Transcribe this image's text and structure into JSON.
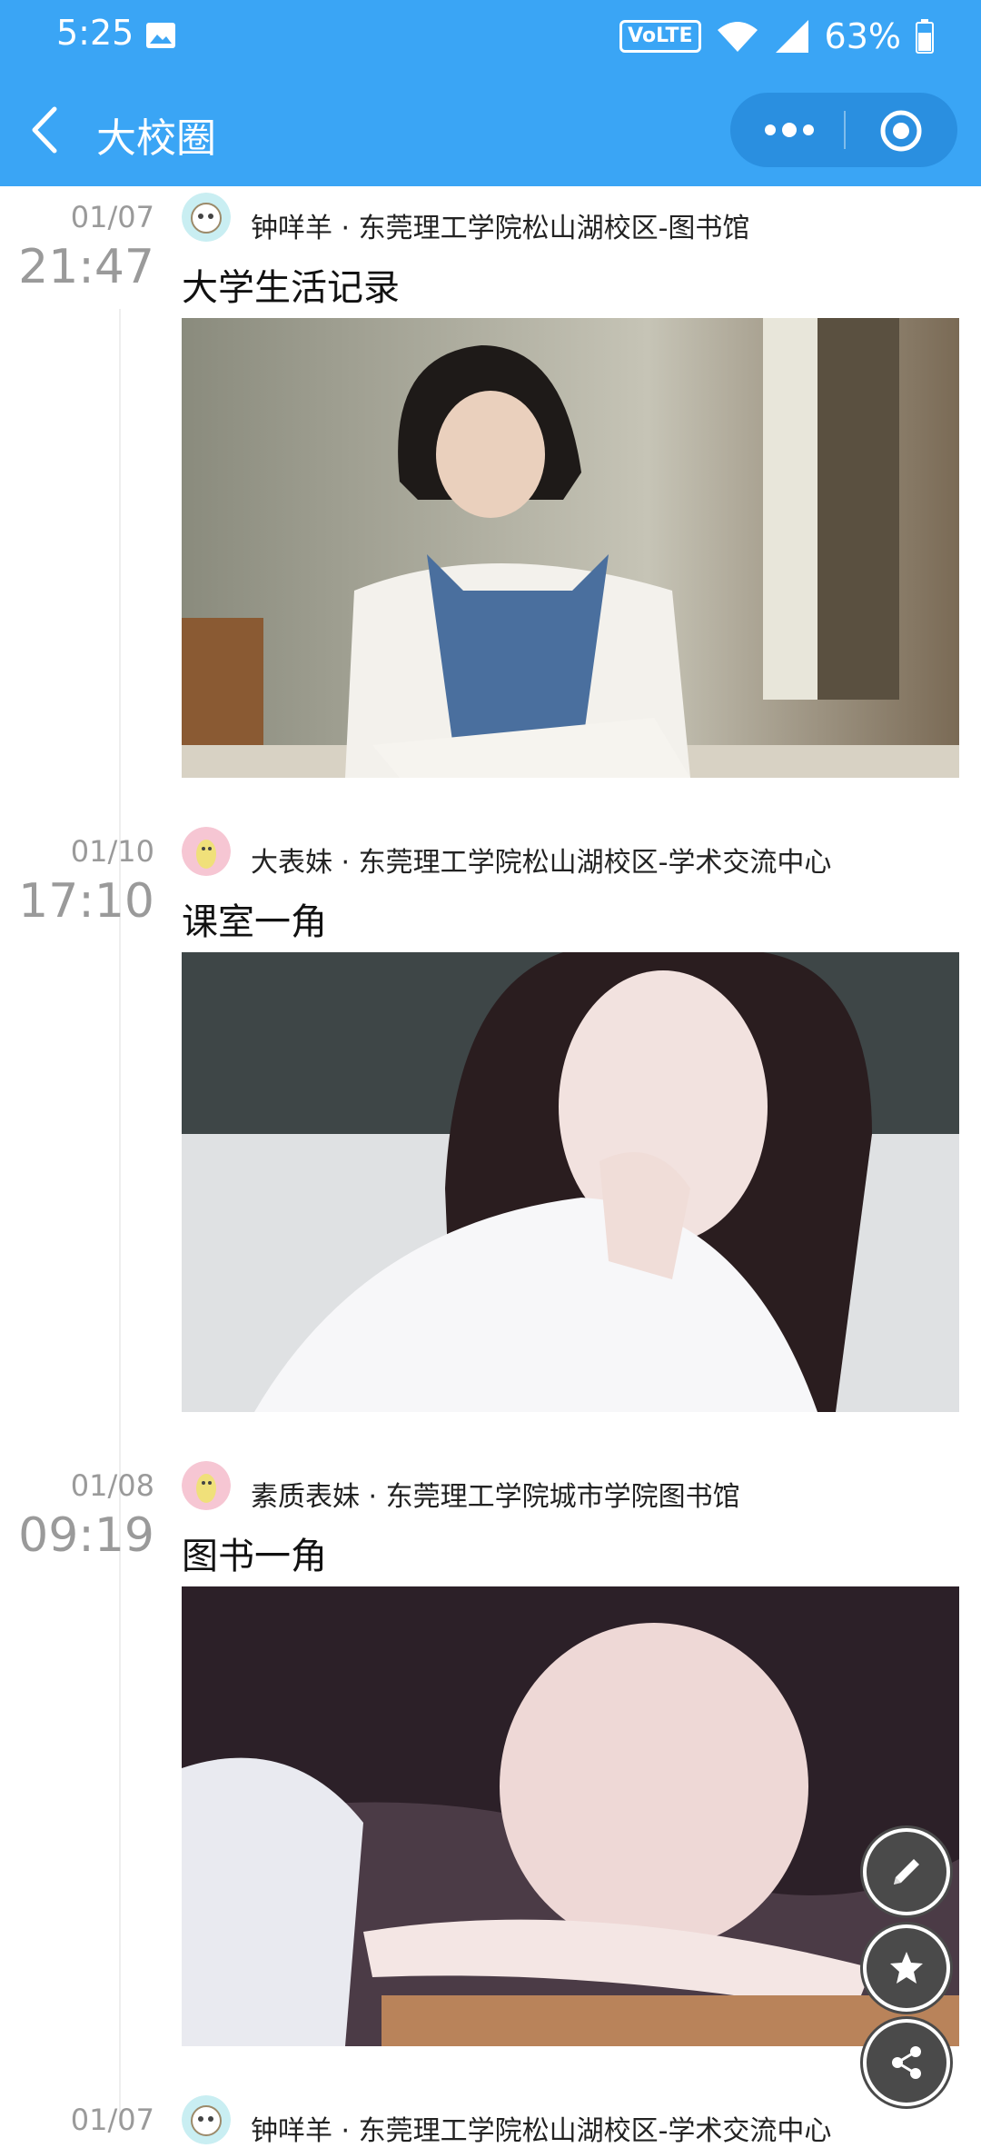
{
  "status_bar": {
    "time": "5:25",
    "volte": "VoLTE",
    "battery": "63%"
  },
  "nav": {
    "title": "大校圈"
  },
  "posts": [
    {
      "date": "01/07",
      "time": "21:47",
      "author": "钟咩羊",
      "location": "东莞理工学院松山湖校区-图书馆",
      "meta": "钟咩羊 · 东莞理工学院松山湖校区-图书馆",
      "title": "大学生活记录"
    },
    {
      "date": "01/10",
      "time": "17:10",
      "author": "大表妹",
      "location": "东莞理工学院松山湖校区-学术交流中心",
      "meta": "大表妹 · 东莞理工学院松山湖校区-学术交流中心",
      "title": "课室一角"
    },
    {
      "date": "01/08",
      "time": "09:19",
      "author": "素质表妹",
      "location": "东莞理工学院城市学院图书馆",
      "meta": "素质表妹 · 东莞理工学院城市学院图书馆",
      "title": "图书一角"
    },
    {
      "date": "01/07",
      "time": "",
      "author": "钟咩羊",
      "location": "东莞理工学院松山湖校区-学术交流中心",
      "meta": "钟咩羊 · 东莞理工学院松山湖校区-学术交流中心",
      "title": ""
    }
  ],
  "colors": {
    "accent": "#3aa5f5",
    "fab": "#4a4a4a"
  },
  "icons": {
    "back": "chevron-left-icon",
    "more": "more-dots-icon",
    "close_target": "target-icon",
    "edit": "pencil-icon",
    "favorite": "star-icon",
    "share": "share-icon"
  }
}
